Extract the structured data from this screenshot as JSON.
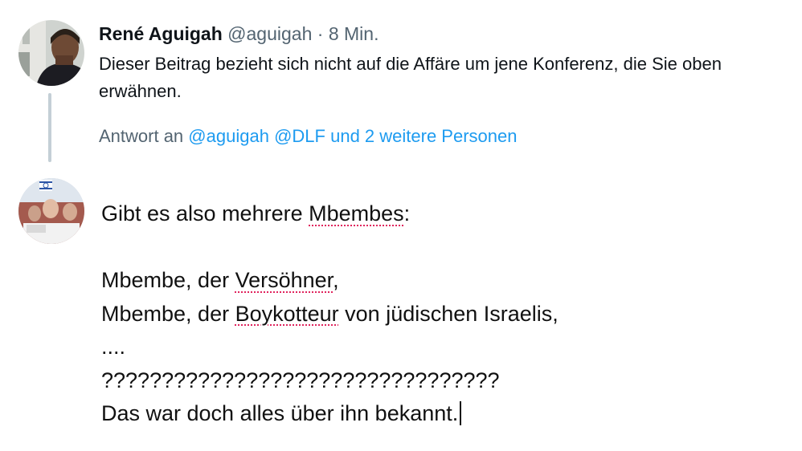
{
  "tweet": {
    "author_name": "René Aguigah",
    "handle": "@aguigah",
    "separator": "·",
    "time": "8 Min.",
    "text": "Dieser Beitrag bezieht sich nicht auf die Affäre um jene Konferenz, die Sie oben erwähnen."
  },
  "reply_context": {
    "prefix": "Antwort an",
    "mention_1": "@aguigah",
    "mention_2": "@DLF",
    "others": "und 2 weitere Personen"
  },
  "composer": {
    "line1_a": "Gibt es also mehrere ",
    "line1_b": "Mbembes",
    "line1_c": ":",
    "line2": "",
    "line3_a": "Mbembe, der ",
    "line3_b": "Versöhner",
    "line3_c": ",",
    "line4_a": "Mbembe, der ",
    "line4_b": "Boykotteur",
    "line4_c": " von jüdischen Israelis,",
    "line5": "....",
    "line6": "?????????????????????????????????",
    "line7": "Das war doch alles über ihn bekannt."
  },
  "icons": {
    "avatar_top": "profile-photo",
    "avatar_reply": "profile-photo"
  }
}
